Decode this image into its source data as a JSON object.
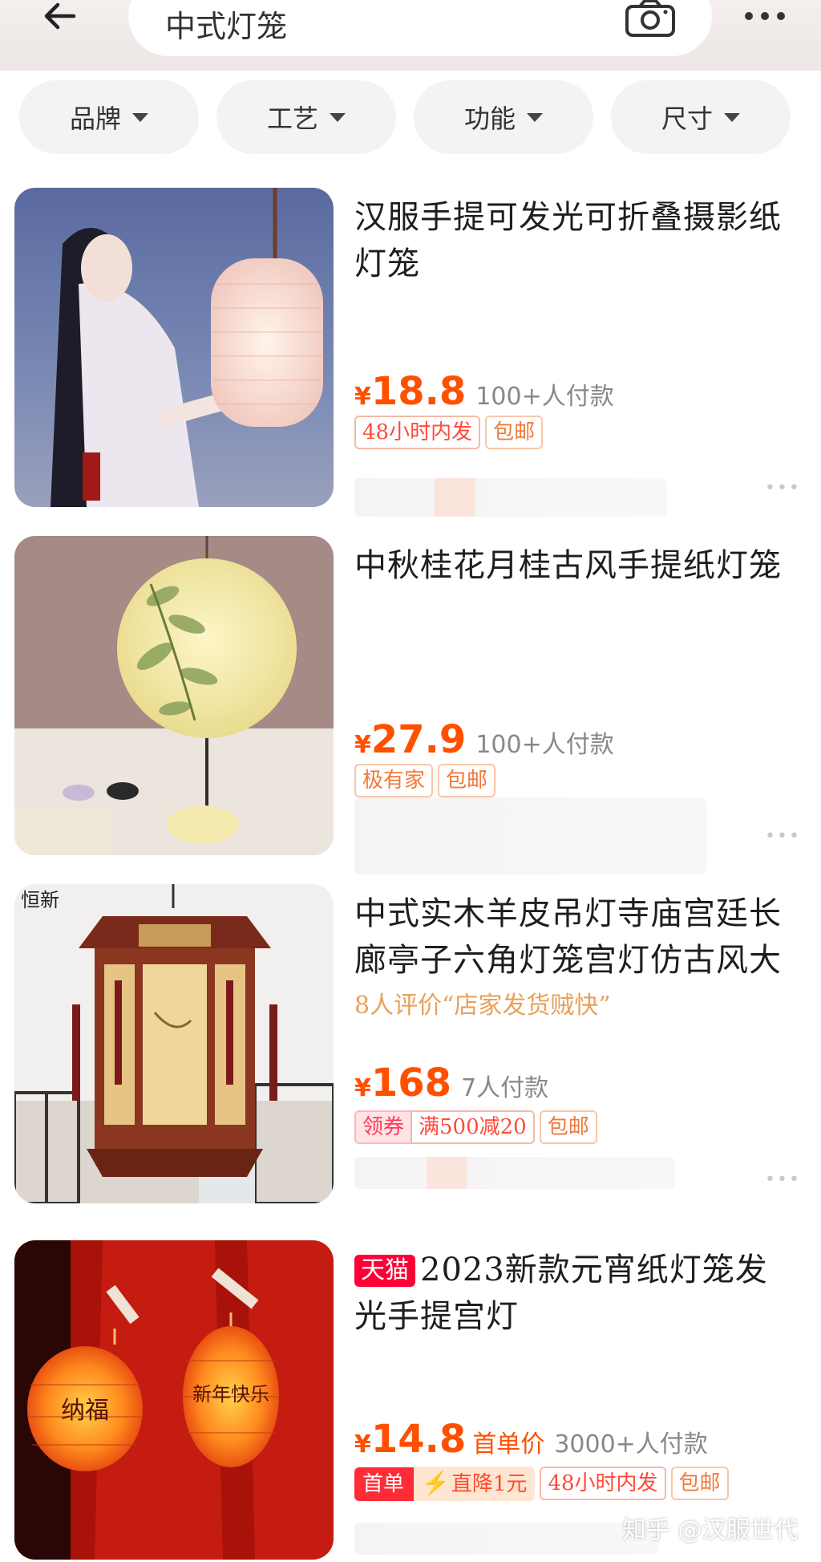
{
  "header": {
    "search_text": "中式灯笼",
    "back_icon": "arrow-left-icon",
    "camera_icon": "camera-icon",
    "more_icon": "more-dots-icon"
  },
  "filters": [
    "品牌",
    "工艺",
    "功能",
    "尺寸"
  ],
  "products": [
    {
      "title_line1": "汉服手提可发光可折叠摄影纸",
      "title_line2": "灯笼",
      "price_symbol": "¥",
      "price": "18.8",
      "sales": "100+人付款",
      "tags": [
        "48小时内发",
        "包邮"
      ]
    },
    {
      "title_line1": "中秋桂花月桂古风手提纸灯笼",
      "price_symbol": "¥",
      "price": "27.9",
      "sales": "100+人付款",
      "tags": [
        "极有家",
        "包邮"
      ]
    },
    {
      "title_line1": "中式实木羊皮吊灯寺庙宫廷长",
      "title_line2": "廊亭子六角灯笼宫灯仿古风大",
      "review": "8人评价“店家发货贼快”",
      "price_symbol": "¥",
      "price": "168",
      "sales": "7人付款",
      "coupon_label": "领券",
      "coupon_amount": "满500减20",
      "tags": [
        "包邮"
      ],
      "image_brand": "恒新"
    },
    {
      "badge": "天猫",
      "title_line1": "2023新款元宵纸灯笼发",
      "title_line2": "光手提宫灯",
      "price_symbol": "¥",
      "price": "14.8",
      "price_note": "首单价",
      "sales": "3000+人付款",
      "first_order_label": "首单",
      "first_order_discount": "直降1元",
      "tags": [
        "48小时内发",
        "包邮"
      ],
      "lantern_text_left": "纳福",
      "lantern_text_right": "新年快乐"
    }
  ],
  "watermark": "知乎 @汉服世代",
  "colors": {
    "price": "#ff5000",
    "tmall": "#ff0036",
    "review": "#e9a05a"
  }
}
